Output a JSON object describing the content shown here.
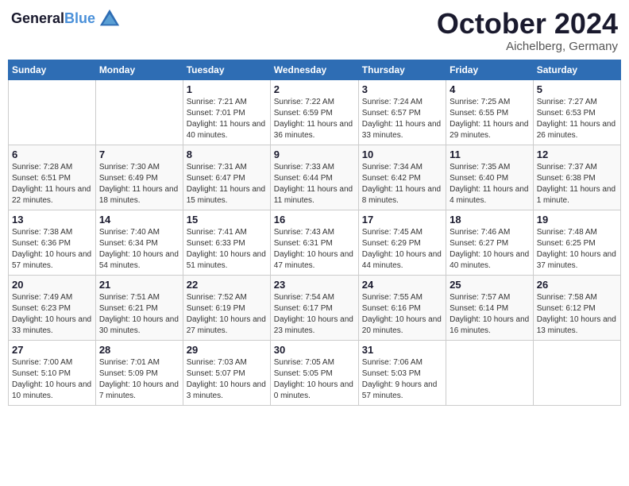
{
  "header": {
    "logo_line1": "General",
    "logo_line2": "Blue",
    "month": "October 2024",
    "location": "Aichelberg, Germany"
  },
  "days_of_week": [
    "Sunday",
    "Monday",
    "Tuesday",
    "Wednesday",
    "Thursday",
    "Friday",
    "Saturday"
  ],
  "weeks": [
    [
      {
        "day": "",
        "info": ""
      },
      {
        "day": "",
        "info": ""
      },
      {
        "day": "1",
        "info": "Sunrise: 7:21 AM\nSunset: 7:01 PM\nDaylight: 11 hours and 40 minutes."
      },
      {
        "day": "2",
        "info": "Sunrise: 7:22 AM\nSunset: 6:59 PM\nDaylight: 11 hours and 36 minutes."
      },
      {
        "day": "3",
        "info": "Sunrise: 7:24 AM\nSunset: 6:57 PM\nDaylight: 11 hours and 33 minutes."
      },
      {
        "day": "4",
        "info": "Sunrise: 7:25 AM\nSunset: 6:55 PM\nDaylight: 11 hours and 29 minutes."
      },
      {
        "day": "5",
        "info": "Sunrise: 7:27 AM\nSunset: 6:53 PM\nDaylight: 11 hours and 26 minutes."
      }
    ],
    [
      {
        "day": "6",
        "info": "Sunrise: 7:28 AM\nSunset: 6:51 PM\nDaylight: 11 hours and 22 minutes."
      },
      {
        "day": "7",
        "info": "Sunrise: 7:30 AM\nSunset: 6:49 PM\nDaylight: 11 hours and 18 minutes."
      },
      {
        "day": "8",
        "info": "Sunrise: 7:31 AM\nSunset: 6:47 PM\nDaylight: 11 hours and 15 minutes."
      },
      {
        "day": "9",
        "info": "Sunrise: 7:33 AM\nSunset: 6:44 PM\nDaylight: 11 hours and 11 minutes."
      },
      {
        "day": "10",
        "info": "Sunrise: 7:34 AM\nSunset: 6:42 PM\nDaylight: 11 hours and 8 minutes."
      },
      {
        "day": "11",
        "info": "Sunrise: 7:35 AM\nSunset: 6:40 PM\nDaylight: 11 hours and 4 minutes."
      },
      {
        "day": "12",
        "info": "Sunrise: 7:37 AM\nSunset: 6:38 PM\nDaylight: 11 hours and 1 minute."
      }
    ],
    [
      {
        "day": "13",
        "info": "Sunrise: 7:38 AM\nSunset: 6:36 PM\nDaylight: 10 hours and 57 minutes."
      },
      {
        "day": "14",
        "info": "Sunrise: 7:40 AM\nSunset: 6:34 PM\nDaylight: 10 hours and 54 minutes."
      },
      {
        "day": "15",
        "info": "Sunrise: 7:41 AM\nSunset: 6:33 PM\nDaylight: 10 hours and 51 minutes."
      },
      {
        "day": "16",
        "info": "Sunrise: 7:43 AM\nSunset: 6:31 PM\nDaylight: 10 hours and 47 minutes."
      },
      {
        "day": "17",
        "info": "Sunrise: 7:45 AM\nSunset: 6:29 PM\nDaylight: 10 hours and 44 minutes."
      },
      {
        "day": "18",
        "info": "Sunrise: 7:46 AM\nSunset: 6:27 PM\nDaylight: 10 hours and 40 minutes."
      },
      {
        "day": "19",
        "info": "Sunrise: 7:48 AM\nSunset: 6:25 PM\nDaylight: 10 hours and 37 minutes."
      }
    ],
    [
      {
        "day": "20",
        "info": "Sunrise: 7:49 AM\nSunset: 6:23 PM\nDaylight: 10 hours and 33 minutes."
      },
      {
        "day": "21",
        "info": "Sunrise: 7:51 AM\nSunset: 6:21 PM\nDaylight: 10 hours and 30 minutes."
      },
      {
        "day": "22",
        "info": "Sunrise: 7:52 AM\nSunset: 6:19 PM\nDaylight: 10 hours and 27 minutes."
      },
      {
        "day": "23",
        "info": "Sunrise: 7:54 AM\nSunset: 6:17 PM\nDaylight: 10 hours and 23 minutes."
      },
      {
        "day": "24",
        "info": "Sunrise: 7:55 AM\nSunset: 6:16 PM\nDaylight: 10 hours and 20 minutes."
      },
      {
        "day": "25",
        "info": "Sunrise: 7:57 AM\nSunset: 6:14 PM\nDaylight: 10 hours and 16 minutes."
      },
      {
        "day": "26",
        "info": "Sunrise: 7:58 AM\nSunset: 6:12 PM\nDaylight: 10 hours and 13 minutes."
      }
    ],
    [
      {
        "day": "27",
        "info": "Sunrise: 7:00 AM\nSunset: 5:10 PM\nDaylight: 10 hours and 10 minutes."
      },
      {
        "day": "28",
        "info": "Sunrise: 7:01 AM\nSunset: 5:09 PM\nDaylight: 10 hours and 7 minutes."
      },
      {
        "day": "29",
        "info": "Sunrise: 7:03 AM\nSunset: 5:07 PM\nDaylight: 10 hours and 3 minutes."
      },
      {
        "day": "30",
        "info": "Sunrise: 7:05 AM\nSunset: 5:05 PM\nDaylight: 10 hours and 0 minutes."
      },
      {
        "day": "31",
        "info": "Sunrise: 7:06 AM\nSunset: 5:03 PM\nDaylight: 9 hours and 57 minutes."
      },
      {
        "day": "",
        "info": ""
      },
      {
        "day": "",
        "info": ""
      }
    ]
  ]
}
